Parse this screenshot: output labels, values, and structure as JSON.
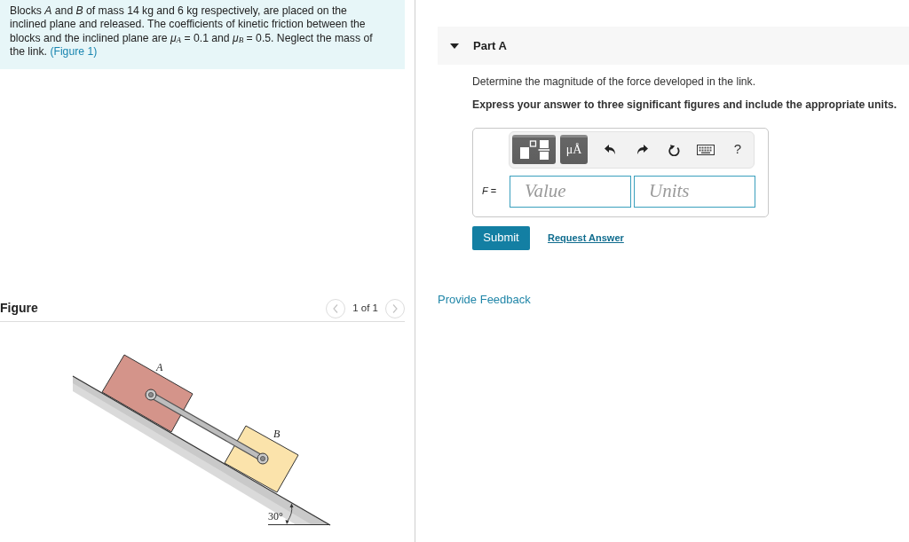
{
  "problem": {
    "text": "Blocks *A* and *B* of mass 14 kg and 6 kg respectively, are placed on the inclined plane and released. The coefficients of kinetic friction between the blocks and the inclined plane are *μ*$_{A}$ = 0.1 and *μ*$_{B}$ = 0.5. Neglect the mass of the link.",
    "figure_link": "(Figure 1)"
  },
  "figure": {
    "title": "Figure",
    "pager": {
      "text": "1 of 1",
      "previous_disabled": true,
      "next_disabled": true
    },
    "block_labels": [
      "A",
      "B"
    ],
    "angle_label": "30°"
  },
  "part": {
    "title": "Part A",
    "expanded": true,
    "question": "Determine the magnitude of the force developed in the link.",
    "instruction": "Express your answer to three significant figures and include the appropriate units.",
    "toolbar": [
      {
        "kind": "templates"
      },
      {
        "kind": "symbols",
        "text": "μÅ"
      },
      {
        "kind": "undo"
      },
      {
        "kind": "redo"
      },
      {
        "kind": "reset"
      },
      {
        "kind": "keyboard"
      },
      {
        "kind": "help",
        "text": "?"
      }
    ],
    "answer": {
      "label": "*F* =",
      "value_placeholder": "Value",
      "units_placeholder": "Units"
    },
    "submit": "Submit",
    "request_answer": "Request Answer"
  },
  "feedback": "Provide Feedback"
}
